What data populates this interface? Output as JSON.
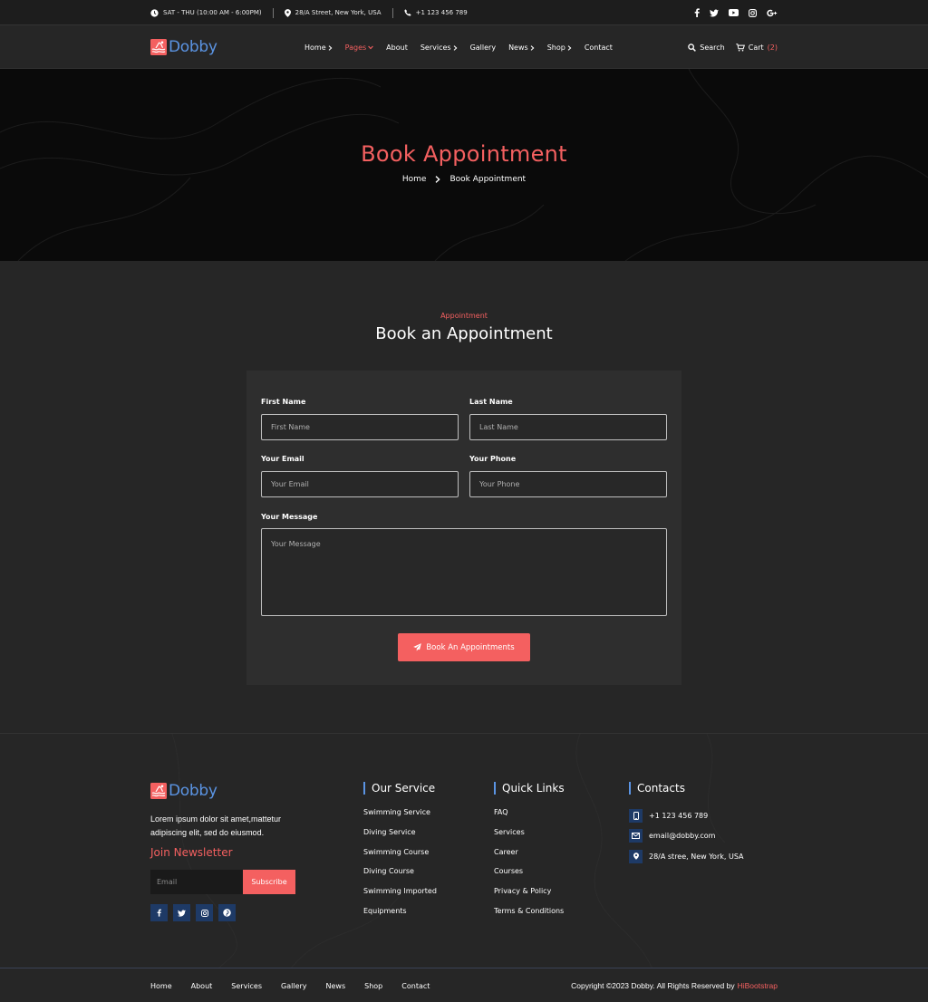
{
  "topbar": {
    "hours": "SAT - THU (10:00 AM - 6:00PM)",
    "address": "28/A Street, New York, USA",
    "phone": "+1 123 456 789",
    "social_icons": [
      "facebook-icon",
      "twitter-icon",
      "youtube-icon",
      "instagram-icon",
      "google-plus-icon"
    ]
  },
  "brand": {
    "name": "Dobby",
    "text_color": "#5b94e3",
    "logo_color": "#f46060"
  },
  "nav": {
    "items": [
      {
        "label": "Home",
        "has_dropdown": true,
        "active": false
      },
      {
        "label": "Pages",
        "has_dropdown": true,
        "active": true
      },
      {
        "label": "About",
        "has_dropdown": false,
        "active": false
      },
      {
        "label": "Services",
        "has_dropdown": true,
        "active": false
      },
      {
        "label": "Gallery",
        "has_dropdown": false,
        "active": false
      },
      {
        "label": "News",
        "has_dropdown": true,
        "active": false
      },
      {
        "label": "Shop",
        "has_dropdown": true,
        "active": false
      },
      {
        "label": "Contact",
        "has_dropdown": false,
        "active": false
      }
    ],
    "search_label": "Search",
    "cart_label": "Cart",
    "cart_count": "(2)"
  },
  "hero": {
    "title": "Book Appointment",
    "breadcrumb": {
      "home": "Home",
      "current": "Book Appointment"
    }
  },
  "section": {
    "subtitle": "Appointment",
    "title": "Book an Appointment"
  },
  "form": {
    "first_name_label": "First Name",
    "first_name_placeholder": "First Name",
    "last_name_label": "Last Name",
    "last_name_placeholder": "Last Name",
    "email_label": "Your Email",
    "email_placeholder": "Your Email",
    "phone_label": "Your Phone",
    "phone_placeholder": "Your Phone",
    "message_label": "Your Message",
    "message_placeholder": "Your Message",
    "submit_label": "Book An Appointments"
  },
  "footer": {
    "about_text": "Lorem ipsum dolor sit amet,mattetur adipiscing elit, sed do eiusmod.",
    "newsletter_title": "Join Newsletter",
    "newsletter_placeholder": "Email",
    "subscribe_label": "Subscribe",
    "social_icons": [
      "facebook-icon",
      "twitter-icon",
      "instagram-icon",
      "pinterest-icon"
    ],
    "service_title": "Our Service",
    "services": [
      "Swimming Service",
      "Diving Service",
      "Swimming Course",
      "Diving Course",
      "Swimming Imported",
      "Equipments"
    ],
    "links_title": "Quick Links",
    "links": [
      "FAQ",
      "Services",
      "Career",
      "Courses",
      "Privacy & Policy",
      "Terms & Conditions"
    ],
    "contacts_title": "Contacts",
    "contacts": [
      {
        "icon": "mobile-icon",
        "text": "+1 123 456 789"
      },
      {
        "icon": "envelope-icon",
        "text": "email@dobby.com"
      },
      {
        "icon": "map-marker-icon",
        "text": "28/A stree, New York, USA"
      }
    ]
  },
  "bottom": {
    "links": [
      "Home",
      "About",
      "Services",
      "Gallery",
      "News",
      "Shop",
      "Contact"
    ],
    "copyright": "Copyright ©2023 Dobby. All Rights Reserved by",
    "credit": "HiBootstrap"
  },
  "colors": {
    "accent": "#f46060",
    "brand_blue": "#5b94e3",
    "icon_bg": "#1e3a66"
  }
}
